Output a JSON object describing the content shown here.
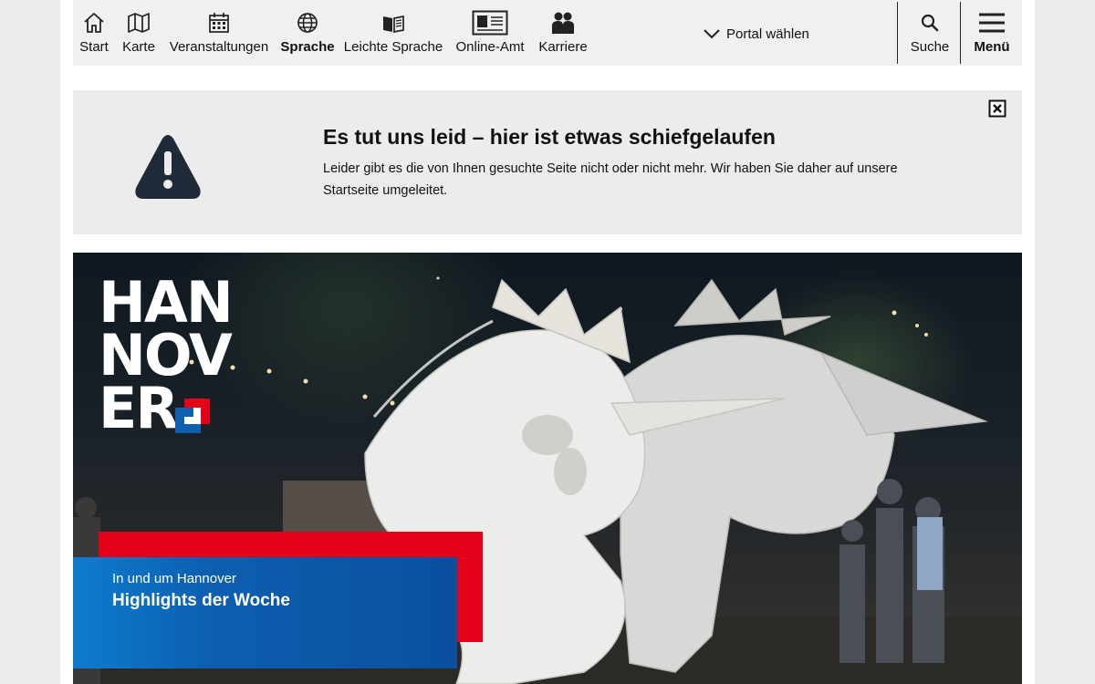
{
  "nav": {
    "items": [
      {
        "label": "Start",
        "icon": "home-icon"
      },
      {
        "label": "Karte",
        "icon": "map-icon"
      },
      {
        "label": "Veranstaltungen",
        "icon": "calendar-icon"
      },
      {
        "label": "Sprache",
        "icon": "globe-icon"
      },
      {
        "label": "Leichte Sprache",
        "icon": "book-icon"
      },
      {
        "label": "Online-Amt",
        "icon": "id-card-icon"
      },
      {
        "label": "Karriere",
        "icon": "people-icon"
      }
    ],
    "portal_label": "Portal wählen",
    "search_label": "Suche",
    "menu_label": "Menü"
  },
  "error": {
    "title": "Es tut uns leid – hier ist etwas schiefgelaufen",
    "text": "Leider gibt es die von Ihnen gesuchte Seite nicht oder nicht mehr. Wir haben Sie daher auf unsere Startseite umgeleitet.",
    "icon": "warning-icon",
    "close_icon": "close-icon"
  },
  "hero": {
    "logo_lines": [
      "HAN",
      "NOV",
      "ER"
    ],
    "teaser_kicker": "In und um Hannover",
    "teaser_title": "Highlights der Woche"
  },
  "colors": {
    "brand_red": "#e2001a",
    "brand_blue": "#0d5fb0",
    "nav_bg": "#f0f0f0",
    "alert_bg": "#ececec"
  }
}
